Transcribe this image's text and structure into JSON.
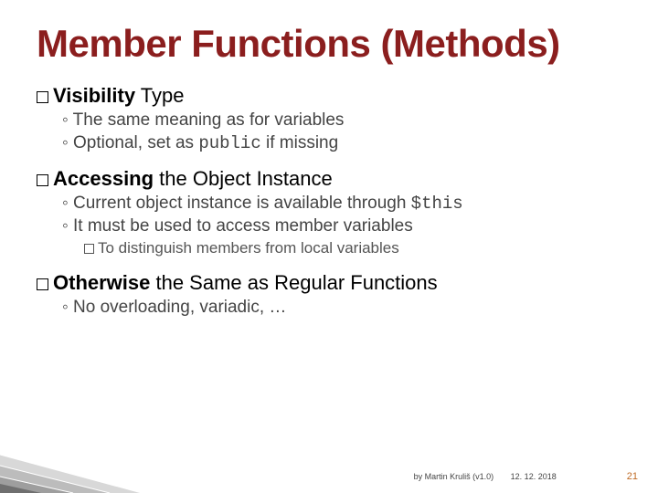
{
  "title": "Member Functions (Methods)",
  "sections": [
    {
      "heading_a": "Visibility",
      "heading_b": " Type",
      "subs": [
        "The same meaning as for variables",
        "Optional, set as "
      ],
      "sub1_tail_code": "public",
      "sub1_tail_text": " if missing"
    },
    {
      "heading_a": "Accessing",
      "heading_b": " the Object Instance",
      "subs": [
        "Current object instance is available through ",
        "It must be used to access member variables"
      ],
      "sub0_tail_code": "$this",
      "sub2": "To distinguish members from local variables"
    },
    {
      "heading_a": "Otherwise",
      "heading_b": " the Same as Regular Functions",
      "subs": [
        "No overloading, variadic, …"
      ]
    }
  ],
  "footer": {
    "author": "by Martin Kruliš (v1.0)",
    "date": "12. 12. 2018"
  },
  "page_number": "21"
}
